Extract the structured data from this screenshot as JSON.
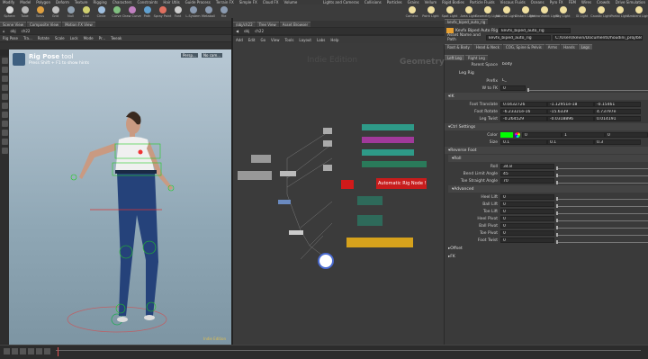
{
  "menubar": {
    "items": [
      "Modify",
      "Model",
      "Polygon",
      "Deform",
      "Texture",
      "Rigging",
      "Characters",
      "Constraints",
      "Hair Utils",
      "Guide Process",
      "Terrain FX",
      "Simple FX",
      "Cloud FX",
      "Volume"
    ],
    "right_items": [
      "Lights and Cameras",
      "Collisions",
      "Particles",
      "Grains",
      "Vellum",
      "Rigid Bodies",
      "Particle Fluids",
      "Viscous Fluids",
      "Oceans",
      "Pyro FX",
      "FEM",
      "Wires",
      "Crowds",
      "Drive Simulation"
    ]
  },
  "shelf": {
    "left_tools": [
      "Sphere",
      "Tube",
      "Torus",
      "Grid",
      "Null",
      "Line",
      "Circle",
      "Curve",
      "Draw Curve",
      "Path",
      "Spray Paint",
      "Font"
    ],
    "mid_tools": [
      "L-System",
      "Metaball",
      "File"
    ],
    "right_tools": [
      "Camera",
      "Point Light",
      "Spot Light",
      "Area Light",
      "Geometry Light",
      "Volume Light",
      "Distant Light",
      "Environment Light",
      "Sky Light",
      "GI Light",
      "Caustic Light",
      "Portal Light",
      "Ambient Light"
    ]
  },
  "scene_tabs": [
    "Scene View",
    "Composite View",
    "Motion FX View"
  ],
  "viewport": {
    "obj_path": "obj",
    "node": "ch22",
    "tool_name": "Rig Pose",
    "toolbar": [
      "Rig Pose",
      "Tra...",
      "Rotate",
      "Scale",
      "Lock",
      "Mode",
      "Pr...",
      "Tweak"
    ],
    "tool_title": "Rig Pose",
    "tool_suffix": "tool",
    "hint": "Press Shift + F1 to show hints",
    "persp": "Persp...",
    "cam": "No cam..."
  },
  "network": {
    "tabs": [
      "/obj/ch22",
      "Tree View",
      "Asset Browser"
    ],
    "path_obj": "obj",
    "path_node": "ch22",
    "menu": [
      "Add",
      "Edit",
      "Go",
      "View",
      "Tools",
      "Layout",
      "Labs",
      "Help"
    ],
    "watermark": "Indie Edition",
    "context": "Geometry",
    "auto_node_label": "Automatic Rig Node !"
  },
  "params": {
    "tab": "kevfx_biped_auto_rig",
    "node_type": "Kevfx Biped Auto Rig",
    "node_name": "kevfx_biped_auto_rig",
    "asset_label": "Asset Name and Path",
    "asset_name": "kevfx_biped_auto_rig",
    "asset_path": "C:/Users/kevin/Documents/houdini_proj/blender...",
    "tabs": [
      "Root & Body",
      "Head & Neck",
      "COG, Spine & Pelvis",
      "Arms",
      "Hands",
      "Legs"
    ],
    "subtabs": [
      "Left Leg",
      "Right Leg"
    ],
    "parent_space_label": "Parent Space",
    "parent_space": "body",
    "leg_rig": "Leg Rig",
    "prefix_label": "Prefix",
    "prefix": "L_",
    "w_fk_label": "W to FK",
    "w_fk": "0",
    "ik": "IK",
    "foot_translate_label": "Foot Translate",
    "foot_translate": [
      "0.0432726",
      "-1.12951e-18",
      "-0.15461"
    ],
    "foot_rotate_label": "Foot Rotate",
    "foot_rotate": [
      "-6.23321e-16",
      "-15.6339",
      "4.73797e"
    ],
    "leg_twist_label": "Leg Twist",
    "leg_twist": [
      "-0.264529",
      "-0.0318896",
      "0.014191"
    ],
    "ctrl_settings": "Ctrl Settings",
    "color_label": "Color",
    "color": [
      "0",
      "1",
      "0"
    ],
    "size_label": "Size",
    "size": [
      "0.1",
      "0.1",
      "0.3"
    ],
    "reverse_foot": "Reverse Foot",
    "roll": "Roll",
    "roll_label": "Roll",
    "roll_val": "34.8",
    "bend_label": "Bend Limit Angle",
    "bend_val": "45",
    "toe_label": "Toe Straight Angle",
    "toe_val": "70",
    "advanced": "Advanced",
    "adv_rows": [
      "Heel Lift",
      "Ball Lift",
      "Toe Lift",
      "Heel Pivot",
      "Ball Pivot",
      "Toe Pivot",
      "Foot Twist"
    ],
    "adv_val": "0",
    "offset": "Offset",
    "fk": "FK"
  },
  "colors": {
    "green": "#00ff00",
    "red_node": "#d11a1a",
    "accent": "#f0a030"
  }
}
